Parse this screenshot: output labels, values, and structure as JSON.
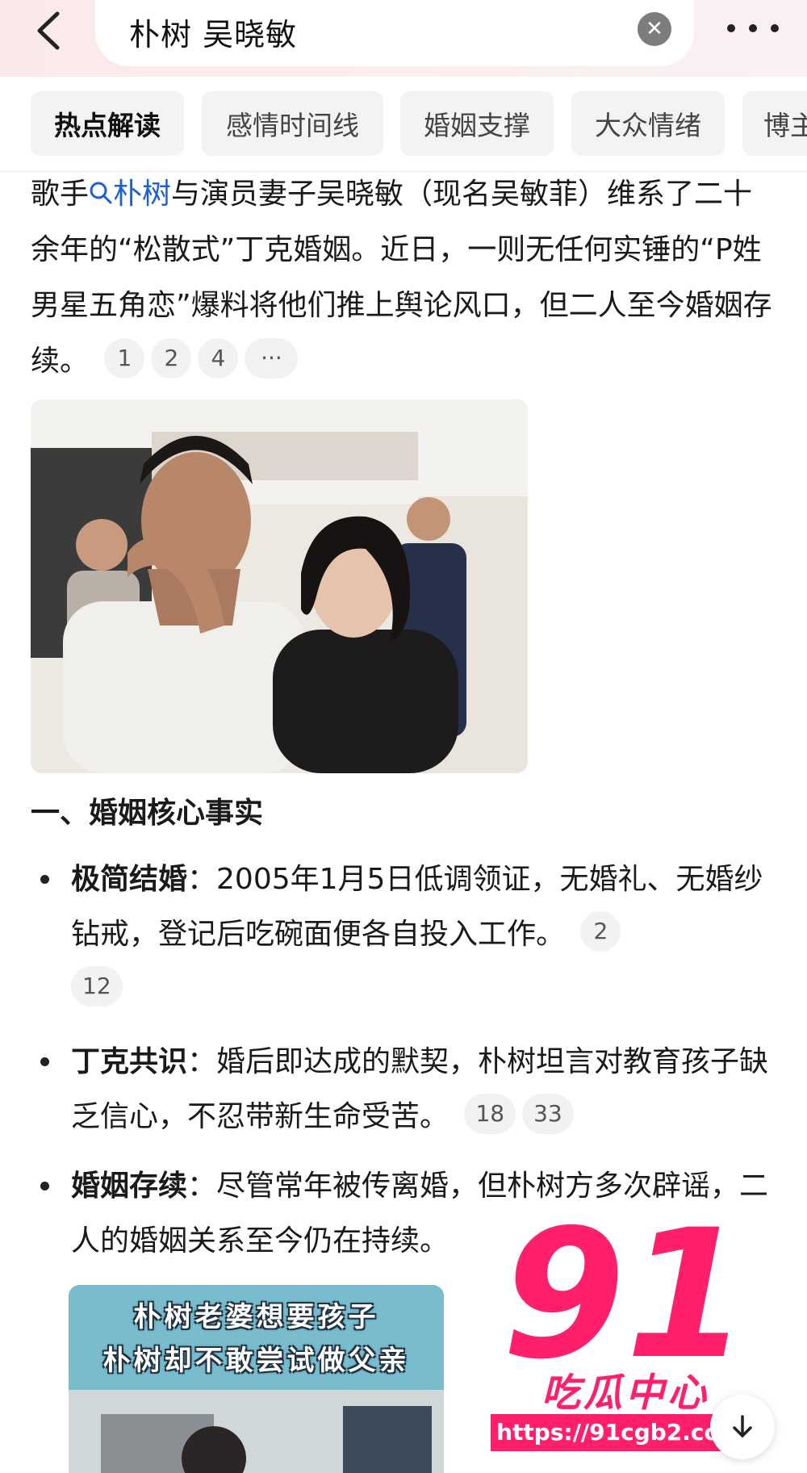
{
  "header": {
    "search_query": "朴树 吴晓敏",
    "clear_icon": "close-icon",
    "back_icon": "chevron-left-icon",
    "more_icon": "more-dots-icon"
  },
  "tabs": [
    {
      "label": "热点解读",
      "active": true
    },
    {
      "label": "感情时间线",
      "active": false
    },
    {
      "label": "婚姻支撑",
      "active": false
    },
    {
      "label": "大众情绪",
      "active": false
    },
    {
      "label": "博主",
      "active": false
    }
  ],
  "intro": {
    "prefix": "歌手",
    "link": "朴树",
    "text": "与演员妻子吴晓敏（现名吴敏菲）维系了二十余年的“松散式”丁克婚姻。近日，一则无任何实锤的“P姓男星五角恋”爆料将他们推上舆论风口，但二人至今婚姻存续。",
    "citations": [
      "1",
      "2",
      "4",
      "···"
    ]
  },
  "section": {
    "heading": "一、婚姻核心事实",
    "bullets": [
      {
        "title": "极简结婚",
        "text": "：2005年1月5日低调领证，无婚礼、无婚纱钻戒，登记后吃碗面便各自投入工作。",
        "citations": [
          "2",
          "12"
        ]
      },
      {
        "title": "丁克共识",
        "text": "：婚后即达成的默契，朴树坦言对教育孩子缺乏信心，不忍带新生命受苦。",
        "citations": [
          "18",
          "33"
        ]
      },
      {
        "title": "婚姻存续",
        "text": "：尽管常年被传离婚，但朴树方多次辟谣，二人的婚姻关系至今仍在持续。"
      }
    ]
  },
  "image2": {
    "caption_line1": "朴树老婆想要孩子",
    "caption_line2": "朴树却不敢尝试做父亲"
  },
  "watermark": {
    "number": "91",
    "name": "吃瓜中心",
    "url": "https://91cgb2.com"
  },
  "colors": {
    "link": "#1c5fd8",
    "watermark_pink": "#ff1f6b",
    "header_bg": "#fbe9ea"
  }
}
